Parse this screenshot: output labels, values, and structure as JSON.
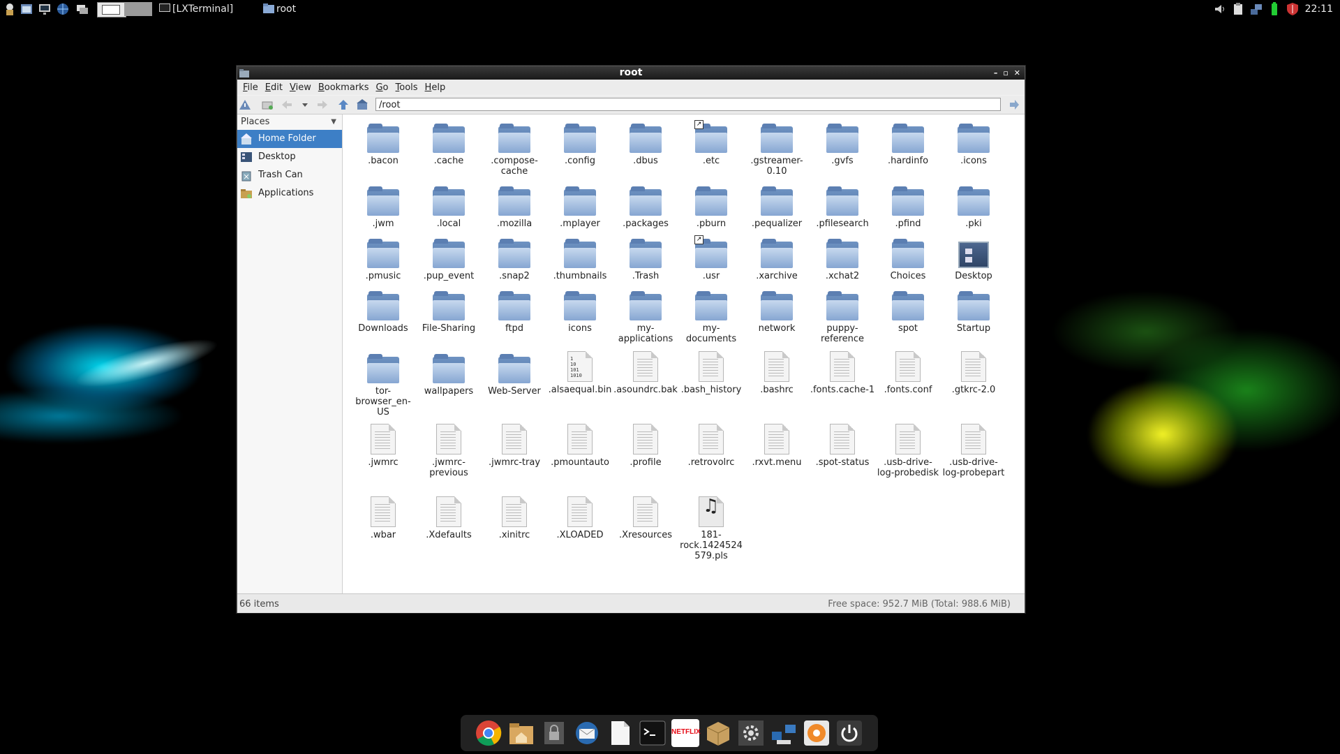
{
  "taskbar": {
    "tasks": [
      "[LXTerminal]",
      "root"
    ],
    "clock": "22:11"
  },
  "window": {
    "title": "root",
    "menu": [
      "File",
      "Edit",
      "View",
      "Bookmarks",
      "Go",
      "Tools",
      "Help"
    ],
    "address": "/root",
    "sidebar": {
      "header": "Places",
      "items": [
        "Home Folder",
        "Desktop",
        "Trash Can",
        "Applications"
      ]
    },
    "status": {
      "count": "66 items",
      "space": "Free space: 952.7 MiB (Total: 988.6 MiB)"
    },
    "files": [
      {
        "name": ".bacon",
        "type": "folder"
      },
      {
        "name": ".cache",
        "type": "folder"
      },
      {
        "name": ".compose-cache",
        "type": "folder"
      },
      {
        "name": ".config",
        "type": "folder"
      },
      {
        "name": ".dbus",
        "type": "folder"
      },
      {
        "name": ".etc",
        "type": "folder",
        "link": true
      },
      {
        "name": ".gstreamer-0.10",
        "type": "folder"
      },
      {
        "name": ".gvfs",
        "type": "folder"
      },
      {
        "name": ".hardinfo",
        "type": "folder"
      },
      {
        "name": ".icons",
        "type": "folder"
      },
      {
        "name": ".jwm",
        "type": "folder"
      },
      {
        "name": ".local",
        "type": "folder"
      },
      {
        "name": ".mozilla",
        "type": "folder"
      },
      {
        "name": ".mplayer",
        "type": "folder"
      },
      {
        "name": ".packages",
        "type": "folder"
      },
      {
        "name": ".pburn",
        "type": "folder"
      },
      {
        "name": ".pequalizer",
        "type": "folder"
      },
      {
        "name": ".pfilesearch",
        "type": "folder"
      },
      {
        "name": ".pfind",
        "type": "folder"
      },
      {
        "name": ".pki",
        "type": "folder"
      },
      {
        "name": ".pmusic",
        "type": "folder"
      },
      {
        "name": ".pup_event",
        "type": "folder"
      },
      {
        "name": ".snap2",
        "type": "folder"
      },
      {
        "name": ".thumbnails",
        "type": "folder"
      },
      {
        "name": ".Trash",
        "type": "folder"
      },
      {
        "name": ".usr",
        "type": "folder",
        "link": true
      },
      {
        "name": ".xarchive",
        "type": "folder"
      },
      {
        "name": ".xchat2",
        "type": "folder"
      },
      {
        "name": "Choices",
        "type": "folder"
      },
      {
        "name": "Desktop",
        "type": "desktop"
      },
      {
        "name": "Downloads",
        "type": "folder"
      },
      {
        "name": "File-Sharing",
        "type": "folder"
      },
      {
        "name": "ftpd",
        "type": "folder"
      },
      {
        "name": "icons",
        "type": "folder"
      },
      {
        "name": "my-applications",
        "type": "folder"
      },
      {
        "name": "my-documents",
        "type": "folder"
      },
      {
        "name": "network",
        "type": "folder"
      },
      {
        "name": "puppy-reference",
        "type": "folder"
      },
      {
        "name": "spot",
        "type": "folder"
      },
      {
        "name": "Startup",
        "type": "folder"
      },
      {
        "name": "tor-browser_en-US",
        "type": "folder"
      },
      {
        "name": "wallpapers",
        "type": "folder"
      },
      {
        "name": "Web-Server",
        "type": "folder"
      },
      {
        "name": ".alsaequal.bin",
        "type": "binary"
      },
      {
        "name": ".asoundrc.bak",
        "type": "text"
      },
      {
        "name": ".bash_history",
        "type": "text"
      },
      {
        "name": ".bashrc",
        "type": "text"
      },
      {
        "name": ".fonts.cache-1",
        "type": "text"
      },
      {
        "name": ".fonts.conf",
        "type": "text"
      },
      {
        "name": ".gtkrc-2.0",
        "type": "text"
      },
      {
        "name": ".jwmrc",
        "type": "text"
      },
      {
        "name": ".jwmrc-previous",
        "type": "text"
      },
      {
        "name": ".jwmrc-tray",
        "type": "text"
      },
      {
        "name": ".pmountauto",
        "type": "text"
      },
      {
        "name": ".profile",
        "type": "text"
      },
      {
        "name": ".retrovolrc",
        "type": "text"
      },
      {
        "name": ".rxvt.menu",
        "type": "text"
      },
      {
        "name": ".spot-status",
        "type": "text"
      },
      {
        "name": ".usb-drive-log-probedisk",
        "type": "text"
      },
      {
        "name": ".usb-drive-log-probepart",
        "type": "text"
      },
      {
        "name": ".wbar",
        "type": "text"
      },
      {
        "name": ".Xdefaults",
        "type": "text"
      },
      {
        "name": ".xinitrc",
        "type": "text"
      },
      {
        "name": ".XLOADED",
        "type": "text"
      },
      {
        "name": ".Xresources",
        "type": "text"
      },
      {
        "name": "181-rock.1424524579.pls",
        "type": "audio"
      }
    ]
  },
  "dock": {
    "icons": [
      "chrome-icon",
      "home-folder-icon",
      "lock-icon",
      "mail-icon",
      "text-editor-icon",
      "terminal-icon",
      "netflix-icon",
      "package-icon",
      "settings-icon",
      "network-icon",
      "media-icon",
      "power-icon"
    ],
    "netflix_label": "NETFLIX"
  }
}
